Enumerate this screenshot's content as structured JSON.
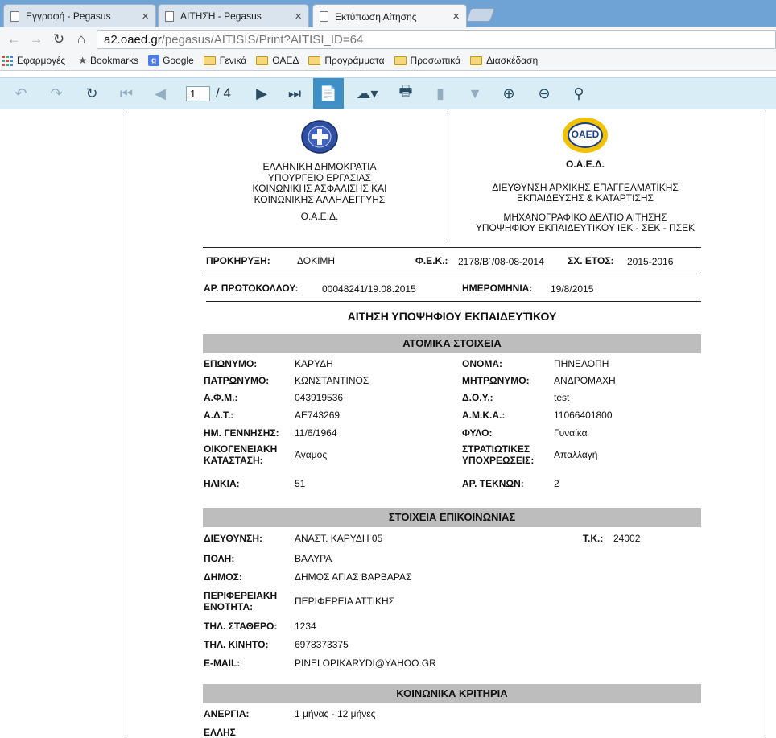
{
  "browser": {
    "tabs": [
      {
        "title": "Εγγραφή - Pegasus",
        "close": "×"
      },
      {
        "title": "ΑΙΤΗΣΗ - Pegasus",
        "close": "×"
      },
      {
        "title": "Εκτύπωση Αίτησης",
        "close": "×"
      }
    ],
    "url_host": "a2.oaed.gr",
    "url_path": "/pegasus/AITISIS/Print?AITISI_ID=64",
    "bookmarks": [
      "Εφαρμογές",
      "Bookmarks",
      "Google",
      "Γενικά",
      "ΟΑΕΔ",
      "Προγράμματα",
      "Προσωπικά",
      "Διασκέδαση"
    ]
  },
  "viewer": {
    "page_current": "1",
    "page_total": "/ 4"
  },
  "doc": {
    "left_header": [
      "ΕΛΛΗΝΙΚΗ ΔΗΜΟΚΡΑΤΙΑ",
      "ΥΠΟΥΡΓΕΙΟ ΕΡΓΑΣΙΑΣ",
      "ΚΟΙΝΩΝΙΚΗΣ ΑΣΦΑΛΙΣΗΣ ΚΑΙ",
      "ΚΟΙΝΩΝΙΚΗΣ ΑΛΛΗΛΕΓΓΥΗΣ"
    ],
    "left_org": "Ο.Α.Ε.Δ.",
    "logo_text": "OAED",
    "right_org": "Ο.Α.Ε.Δ.",
    "right_dept": [
      "ΔΙΕΥΘΥΝΣΗ ΑΡΧΙΚΗΣ ΕΠΑΓΓΕΛΜΑΤΙΚΗΣ",
      "ΕΚΠΑΙΔΕΥΣΗΣ & ΚΑΤΑΡΤΙΣΗΣ"
    ],
    "right_form": [
      "ΜΗΧΑΝΟΓΡΑΦΙΚΟ ΔΕΛΤΙΟ ΑΙΤΗΣΗΣ",
      "ΥΠΟΨΗΦΙΟΥ ΕΚΠΑΙΔΕΥΤΙΚΟΥ ΙΕΚ - ΣΕΚ - ΠΣΕΚ"
    ],
    "prokiryxi_label": "ΠΡΟΚΗΡΥΞΗ:",
    "prokiryxi_value": "ΔΟΚΙΜΗ",
    "fek_label": "Φ.Ε.Κ.:",
    "fek_value": "2178/Β΄/08-08-2014",
    "year_label": "ΣΧ. ΕΤΟΣ:",
    "year_value": "2015-2016",
    "protocol_label": "ΑΡ. ΠΡΩΤΟΚΟΛΛΟΥ:",
    "protocol_value": "00048241/19.08.2015",
    "date_label": "ΗΜΕΡΟΜΗΝΙΑ:",
    "date_value": "19/8/2015",
    "title": "ΑΙΤΗΣΗ ΥΠΟΨΗΦΙΟΥ ΕΚΠΑΙΔΕΥΤΙΚΟΥ",
    "personal": {
      "heading": "ΑΤΟΜΙΚΑ ΣΤΟΙΧΕΙΑ",
      "surname_label": "ΕΠΩΝΥΜΟ:",
      "surname": "ΚΑΡΥΔΗ",
      "name_label": "ΟΝΟΜΑ:",
      "name": "ΠΗΝΕΛΟΠΗ",
      "father_label": "ΠΑΤΡΩΝΥΜΟ:",
      "father": "ΚΩΝΣΤΑΝΤΙΝΟΣ",
      "mother_label": "ΜΗΤΡΩΝΥΜΟ:",
      "mother": "ΑΝΔΡΟΜΑΧΗ",
      "afm_label": "Α.Φ.Μ.:",
      "afm": "043919536",
      "doy_label": "Δ.Ο.Υ.:",
      "doy": "test",
      "adt_label": "Α.Δ.Τ.:",
      "adt": "ΑΕ743269",
      "amka_label": "Α.Μ.Κ.Α.:",
      "amka": "11066401800",
      "birth_label": "ΗΜ. ΓΕΝΝΗΣΗΣ:",
      "birth": "11/6/1964",
      "sex_label": "ΦΥΛΟ:",
      "sex": "Γυναίκα",
      "marital_label_1": "ΟΙΚΟΓΕΝΕΙΑΚΗ",
      "marital_label_2": "ΚΑΤΑΣΤΑΣΗ:",
      "marital": "Άγαμος",
      "military_label_1": "ΣΤΡΑΤΙΩΤΙΚΕΣ",
      "military_label_2": "ΥΠΟΧΡΕΩΣΕΙΣ:",
      "military": "Απαλλαγή",
      "age_label": "ΗΛΙΚΙΑ:",
      "age": "51",
      "children_label": "ΑΡ. ΤΕΚΝΩΝ:",
      "children": "2"
    },
    "contact": {
      "heading": "ΣΤΟΙΧΕΙΑ ΕΠΙΚΟΙΝΩΝΙΑΣ",
      "address_label": "ΔΙΕΥΘΥΝΣΗ:",
      "address": "ΑΝΑΣΤ. ΚΑΡΥΔΗ 05",
      "tk_label": "Τ.Κ.:",
      "tk": "24002",
      "city_label": "ΠΟΛΗ:",
      "city": "ΒΑΛΥΡΑ",
      "municipality_label": "ΔΗΜΟΣ:",
      "municipality": "ΔΗΜΟΣ ΑΓΙΑΣ ΒΑΡΒΑΡΑΣ",
      "region_label_1": "ΠΕΡΙΦΕΡΕΙΑΚΗ",
      "region_label_2": "ΕΝΟΤΗΤΑ:",
      "region": "ΠΕΡΙΦΕΡΕΙΑ ΑΤΤΙΚΗΣ",
      "phone_label": "ΤΗΛ. ΣΤΑΘΕΡΟ:",
      "phone": "1234",
      "mobile_label": "ΤΗΛ. ΚΙΝΗΤΟ:",
      "mobile": "6978373375",
      "email_label": "E-MAIL:",
      "email": "PINELOPIKARYDI@YAHOO.GR"
    },
    "social": {
      "heading": "ΚΟΙΝΩΝΙΚΑ ΚΡΙΤΗΡΙΑ",
      "unemployment_label": "ΑΝΕΡΓΙΑ:",
      "unemployment": "1 μήνας - 12 μήνες",
      "next_label": "ΕΛΛΗΣ"
    }
  }
}
